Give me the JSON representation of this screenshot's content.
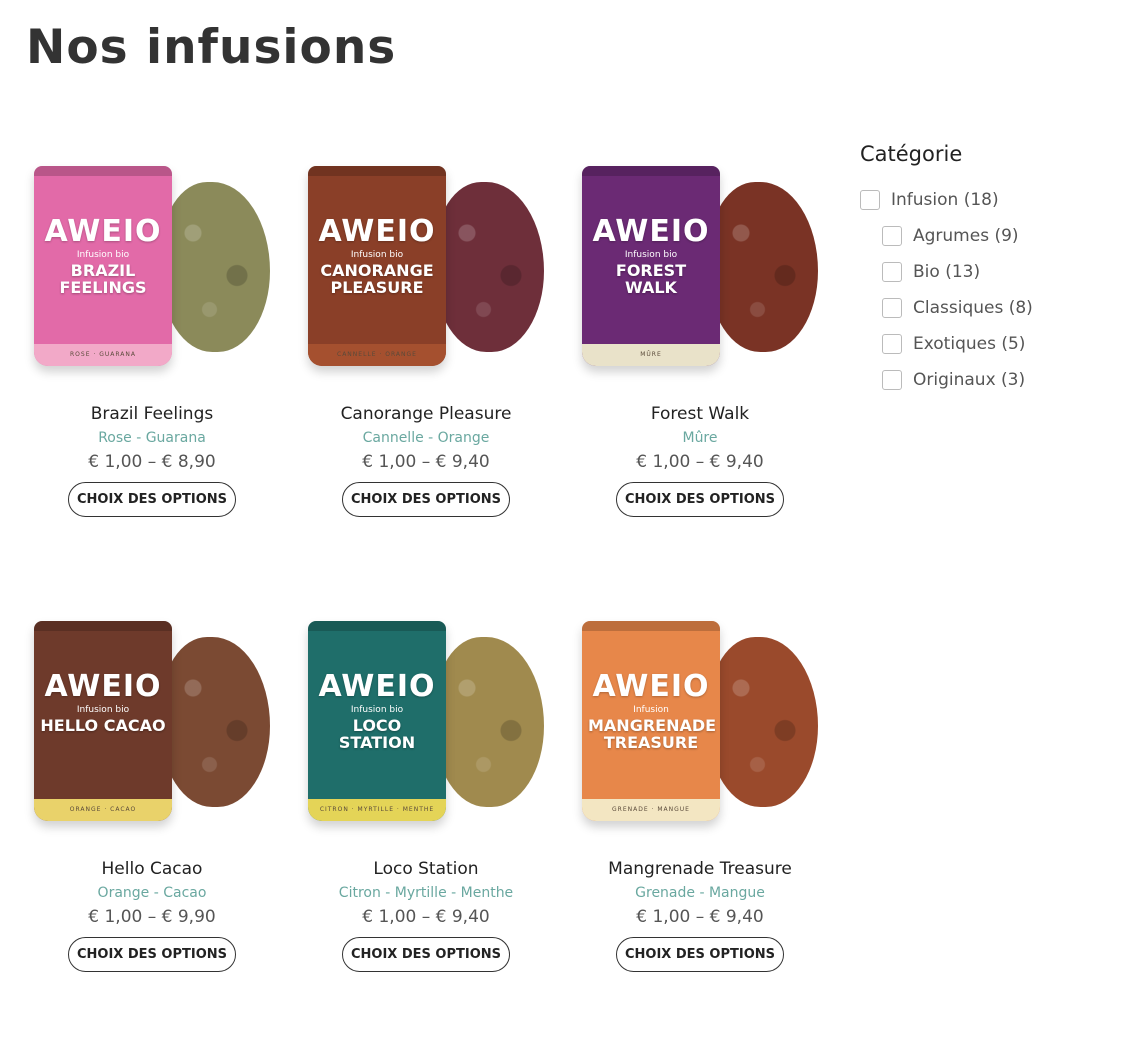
{
  "page": {
    "title": "Nos infusions"
  },
  "button_label": "CHOIX DES OPTIONS",
  "products": [
    {
      "name": "Brazil Feelings",
      "tags": "Rose - Guarana",
      "price": "€ 1,00 – € 8,90",
      "pack": {
        "brand": "AWEIO",
        "subtitle": "Infusion bio",
        "label": "BRAZIL FEELINGS",
        "band": "ROSE · GUARANA",
        "color": "#e26aa8",
        "band_color": "#f2a9c8",
        "heap_color": "#8b8a5a"
      }
    },
    {
      "name": "Canorange Pleasure",
      "tags": "Cannelle - Orange",
      "price": "€ 1,00 – € 9,40",
      "pack": {
        "brand": "AWEIO",
        "subtitle": "Infusion bio",
        "label": "canorange PLEASURE",
        "band": "CANNELLE · ORANGE",
        "color": "#8a3f28",
        "band_color": "#a5502f",
        "heap_color": "#6e2f3a"
      }
    },
    {
      "name": "Forest Walk",
      "tags": "Mûre",
      "price": "€ 1,00 – € 9,40",
      "pack": {
        "brand": "AWEIO",
        "subtitle": "Infusion bio",
        "label": "FOREST WALK",
        "band": "MÛRE",
        "color": "#6b2a74",
        "band_color": "#e9e2c9",
        "heap_color": "#7a3325"
      }
    },
    {
      "name": "Hello Cacao",
      "tags": "Orange - Cacao",
      "price": "€ 1,00 – € 9,90",
      "pack": {
        "brand": "AWEIO",
        "subtitle": "Infusion bio",
        "label": "Hello CACAO",
        "band": "ORANGE · CACAO",
        "color": "#6e3a2b",
        "band_color": "#e9d26a",
        "heap_color": "#7b4a33"
      }
    },
    {
      "name": "Loco Station",
      "tags": "Citron - Myrtille - Menthe",
      "price": "€ 1,00 – € 9,40",
      "pack": {
        "brand": "AWEIO",
        "subtitle": "Infusion bio",
        "label": "LOCO STATION",
        "band": "CITRON · MYRTILLE · MENTHE",
        "color": "#1f6e6a",
        "band_color": "#e4d457",
        "heap_color": "#a08a4e"
      }
    },
    {
      "name": "Mangrenade Treasure",
      "tags": "Grenade - Mangue",
      "price": "€ 1,00 – € 9,40",
      "pack": {
        "brand": "AWEIO",
        "subtitle": "Infusion",
        "label": "MANGRENADE TREASURE",
        "band": "GRENADE · MANGUE",
        "color": "#e7874a",
        "band_color": "#f3e6c2",
        "heap_color": "#9a4a2c"
      }
    }
  ],
  "sidebar": {
    "title": "Catégorie",
    "categories": [
      {
        "label": "Infusion (18)",
        "checked": false,
        "level": 0
      },
      {
        "label": "Agrumes (9)",
        "checked": false,
        "level": 1
      },
      {
        "label": "Bio (13)",
        "checked": false,
        "level": 1
      },
      {
        "label": "Classiques (8)",
        "checked": false,
        "level": 1
      },
      {
        "label": "Exotiques (5)",
        "checked": false,
        "level": 1
      },
      {
        "label": "Originaux (3)",
        "checked": false,
        "level": 1
      }
    ]
  }
}
